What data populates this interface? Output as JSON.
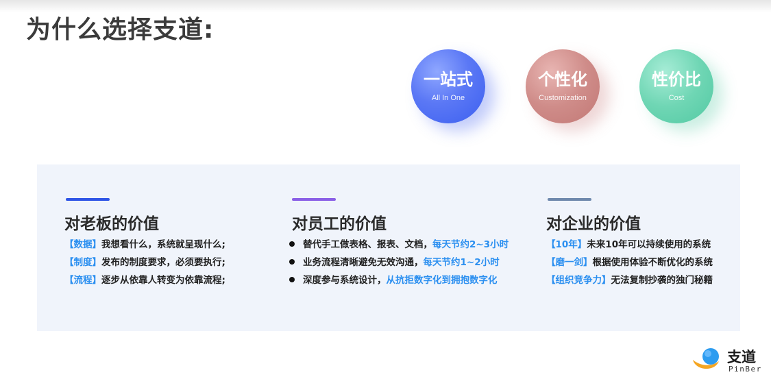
{
  "title": "为什么选择支道:",
  "circles": [
    {
      "title": "一站式",
      "subtitle": "All In One"
    },
    {
      "title": "个性化",
      "subtitle": "Customization"
    },
    {
      "title": "性价比",
      "subtitle": "Cost"
    }
  ],
  "columns": [
    {
      "title": "对老板的价值",
      "accent": "#2f55e6",
      "items": [
        {
          "tag": "【数据】",
          "text": "我想看什么，系统就呈现什么;"
        },
        {
          "tag": "【制度】",
          "text": "发布的制度要求，必须要执行;"
        },
        {
          "tag": "【流程】",
          "text": "逐步从依靠人转变为依靠流程;"
        }
      ]
    },
    {
      "title": "对员工的价值",
      "accent": "#8a5fe6",
      "items": [
        {
          "text": "替代手工做表格、报表、文档，",
          "highlight": "每天节约2~3小时"
        },
        {
          "text": "业务流程清晰避免无效沟通，",
          "highlight": "每天节约1~2小时"
        },
        {
          "text": "深度参与系统设计，",
          "highlight": "从抗拒数字化到拥抱数字化"
        }
      ]
    },
    {
      "title": "对企业的价值",
      "accent": "#6f89ad",
      "items": [
        {
          "tag": "【10年】",
          "text": "未来10年可以持续使用的系统"
        },
        {
          "tag": "【磨一剑】",
          "text": "根据使用体验不断优化的系统"
        },
        {
          "tag": "【组织竞争力】",
          "text": "无法复制抄袭的独门秘籍"
        }
      ]
    }
  ],
  "logo": {
    "name_cn": "支道",
    "name_en": "PinBer"
  },
  "colors": {
    "highlight": "#2b8ff0",
    "panel_bg": "#f0f4fb",
    "title": "#3b3b3b"
  }
}
